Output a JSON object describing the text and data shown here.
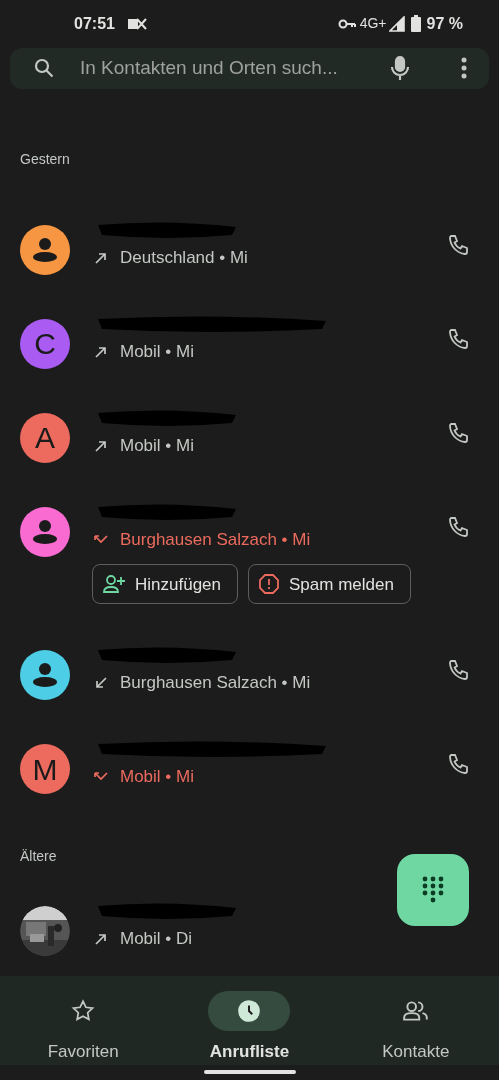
{
  "status_bar": {
    "time": "07:51",
    "network": "4G+",
    "battery": "97 %"
  },
  "search": {
    "placeholder": "In Kontakten und Orten such..."
  },
  "sections": [
    {
      "title": "Gestern",
      "calls": [
        {
          "avatar": {
            "kind": "person",
            "color": "#f79642"
          },
          "kind": "outgoing",
          "missed": false,
          "detail": "Deutschland • Mi"
        },
        {
          "avatar": {
            "kind": "letter",
            "letter": "C",
            "color": "#a95bf2"
          },
          "kind": "outgoing",
          "missed": false,
          "detail": "Mobil • Mi"
        },
        {
          "avatar": {
            "kind": "letter",
            "letter": "A",
            "color": "#ec6a5e"
          },
          "kind": "outgoing",
          "missed": false,
          "detail": "Mobil • Mi"
        },
        {
          "avatar": {
            "kind": "person",
            "color": "#f96bd1"
          },
          "kind": "missed",
          "missed": true,
          "detail": "Burghausen Salzach • Mi",
          "actions": [
            {
              "kind": "add",
              "label": "Hinzufügen"
            },
            {
              "kind": "spam",
              "label": "Spam melden"
            }
          ]
        },
        {
          "avatar": {
            "kind": "person",
            "color": "#4dcde6"
          },
          "kind": "incoming",
          "missed": false,
          "detail": "Burghausen Salzach • Mi"
        },
        {
          "avatar": {
            "kind": "letter",
            "letter": "M",
            "color": "#ec6a5e"
          },
          "kind": "missed",
          "missed": true,
          "detail": "Mobil • Mi"
        }
      ]
    },
    {
      "title": "Ältere",
      "calls": [
        {
          "kind": "outgoing",
          "missed": false,
          "detail": "Mobil • Di"
        }
      ]
    }
  ],
  "nav": [
    {
      "label": "Favoriten",
      "selected": false
    },
    {
      "label": "Anrufliste",
      "selected": true
    },
    {
      "label": "Kontakte",
      "selected": false
    }
  ]
}
